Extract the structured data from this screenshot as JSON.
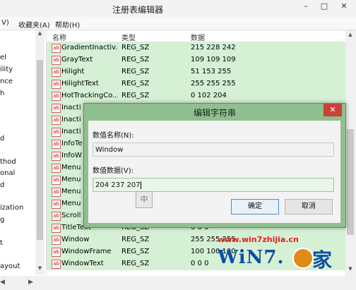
{
  "window": {
    "title": "注册表编辑器",
    "minimize": "–",
    "maximize": "□",
    "close": "✕"
  },
  "menu": {
    "items": [
      "V)",
      "收藏夹(A)",
      "帮助(H)"
    ]
  },
  "tree": {
    "items": [
      "el",
      "ility",
      "nce",
      "h",
      "d",
      "thod",
      "onal",
      "d",
      "ization",
      "g",
      "t",
      "ayout"
    ]
  },
  "list": {
    "headers": {
      "name": "名称",
      "type": "类型",
      "data": "数据"
    },
    "rows": [
      {
        "name": "GradientInactiv...",
        "type": "REG_SZ",
        "data": "215 228 242"
      },
      {
        "name": "GrayText",
        "type": "REG_SZ",
        "data": "109 109 109"
      },
      {
        "name": "Hilight",
        "type": "REG_SZ",
        "data": "51 153 255"
      },
      {
        "name": "HilightText",
        "type": "REG_SZ",
        "data": "255 255 255"
      },
      {
        "name": "HotTrackingCo...",
        "type": "REG_SZ",
        "data": "0 102 204"
      },
      {
        "name": "Inacti",
        "type": "",
        "data": ""
      },
      {
        "name": "Inacti",
        "type": "",
        "data": ""
      },
      {
        "name": "Inacti",
        "type": "",
        "data": ""
      },
      {
        "name": "InfoTe",
        "type": "",
        "data": ""
      },
      {
        "name": "InfoW",
        "type": "",
        "data": ""
      },
      {
        "name": "Menu",
        "type": "",
        "data": ""
      },
      {
        "name": "Menu",
        "type": "",
        "data": ""
      },
      {
        "name": "Menu",
        "type": "",
        "data": ""
      },
      {
        "name": "Menu",
        "type": "",
        "data": ""
      },
      {
        "name": "Scroll",
        "type": "",
        "data": ""
      },
      {
        "name": "TitleText",
        "type": "REG_SZ",
        "data": "0 0 0"
      },
      {
        "name": "Window",
        "type": "REG_SZ",
        "data": "255 255 255"
      },
      {
        "name": "WindowFrame",
        "type": "REG_SZ",
        "data": "100 100 100"
      },
      {
        "name": "WindowText",
        "type": "REG_SZ",
        "data": "0 0 0"
      }
    ]
  },
  "dialog": {
    "title": "编辑字符串",
    "close": "✕",
    "name_label": "数值名称(N):",
    "name_value": "Window",
    "data_label": "数值数据(V):",
    "data_value": "204 237 207",
    "ok": "确定",
    "cancel": "取消"
  },
  "ime": "中",
  "watermark": {
    "url": "www.win7zhijia.cn",
    "logo": "WiN7.",
    "home": "家"
  },
  "colors": {
    "row_green": "#d5f0d4",
    "dialog_frame": "#8fbf8e",
    "close_red": "#c7423b"
  }
}
